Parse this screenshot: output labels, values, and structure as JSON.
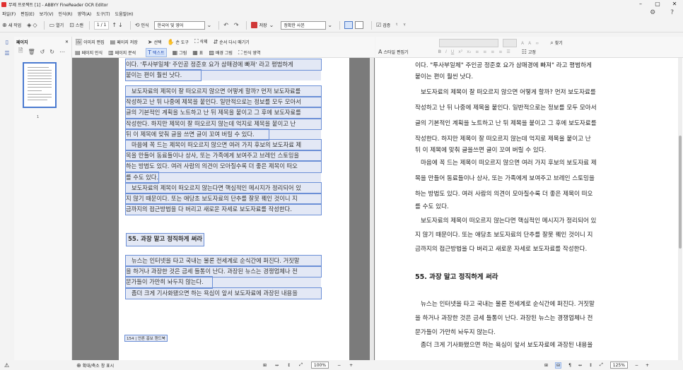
{
  "window": {
    "title": "무제 프로젝트 [1] - ABBYY FineReader OCR Editor",
    "minimize": "–",
    "maximize": "▢",
    "close": "✕"
  },
  "menu": [
    "파일(F)",
    "편집(E)",
    "보기(V)",
    "인식(R)",
    "영역(A)",
    "도구(T)",
    "도움말(H)"
  ],
  "toolbar": {
    "new_task": "새 작업",
    "open": "열기",
    "scan": "스캔",
    "page_counter": "1 / 1",
    "recognize": "인식",
    "language": "한국어 및 영어",
    "save": "저장",
    "save_format": "정확한 사본",
    "verify": "검증"
  },
  "pages_panel": {
    "title": "페이지",
    "page_number": "1"
  },
  "image_toolbar": {
    "row1": [
      "이미지 편집",
      "페이지 저장",
      "선택",
      "손 도구",
      "삭제",
      "순서 다시 매기기"
    ],
    "row2": [
      "페이지 인식",
      "페이지 분석",
      "텍스트",
      "그림",
      "표",
      "배경 그림",
      "인식 영역"
    ]
  },
  "image_page": {
    "lines_top": [
      "이다. '투사부일체' 주인공 정준호 요가 삼매경에 빠져' 라고 평범하게",
      "붙이는 편이 훨씬 낫다."
    ],
    "lines_para2": [
      "보도자료의 제목이 잘 떠오르지 않으면 어떻게 할까? 먼저 보도자료를",
      "작성하고 난 뒤 나중에 제목을 붙인다. 일반적으로는 정보를 모두 모아서",
      "글의 기본적인 계획을 노트하고 난 뒤 제목을 붙이고 그 후에 보도자료를",
      "작성한다. 하지만 제목이 잘 떠오르지 않는데 억지로 제목을 붙이고 난",
      "뒤 이 제목에 맞춰 글을 쓰면 글이 꼬여 버릴 수 있다.",
      "마음에 꼭 드는 제목이 떠오르지 않으면 여러 가지 후보의 보도자료 제",
      "목을 만들어 동료들이나 상사, 또는 가족에게 보여주고 브레인 스토밍을",
      "하는 방법도 있다. 여러 사람의 의견이 모아질수록 더 좋은 제목이 떠오",
      "를 수도 있다.",
      "보도자료의 제목이 떠오르지 않는다면 핵심적인 메시지가 정리되어 있",
      "지 않기 때문이다. 또는 애당초 보도자료의 단추를 잘못 꿰인 것이니 지",
      "금까지의 접근방법을 다 버리고 새로운 자세로 보도자료를 작성한다."
    ],
    "heading": "55. 과장 말고 정직하게 써라",
    "lines_para3": [
      "뉴스는 인터넷을 타고 국내는 물론 전세계로 순식간에 퍼진다. 거짓말",
      "을 하거나 과장한 것은 금세 들통이 난다. 과장된 뉴스는 경쟁업체나 전",
      "문가들이 가만히 놔두지 않는다.",
      "좀더 크게 기사화됐으면 하는 욕심이 앞서 보도자료에 과장된 내용을"
    ],
    "footer": "154 | 언론 홍보 핸드북"
  },
  "text_toolbar": {
    "style_editor": "스타일 편집기",
    "find": "찾기",
    "properties": "고정"
  },
  "text_view": {
    "paragraphs": [
      "이다. \"투사부일체\" 주인공 정준호 요가 삼매경에 빠져\" 라고 평범하게",
      "붙이는 편이 훨씬 낫다.",
      "보도자료의 제목이 잘 떠오르지 않으면 어떻게 할까? 먼저 보도자료를",
      "작성하고 난 뒤 나중에 제목을 붙인다. 일반적으로는 정보를 모두 모아서",
      "글의 기본적인 계획을 노트하고 난 뒤 제목을 붙이고 그 후에 보도자료를",
      "작성한다. 하지만 제목이 잘 떠오르지      않는데 억지로 제목을 붙이고 난",
      "뒤 이 제목에 맞춰 글을쓰면 글이 꼬여 버릴 수 있다.",
      "마음에 꼭 드는 제목이 떠오르지 않으면 여러 가지 후보의 보도자료 제",
      "목을 만들어 동료들이나 상사,      또는 가족에게 보여주고 브레인 스토밍을",
      "하는 방법도 있다. 여러 사람의 의견이 모아질수록 더          좋은 제목이 떠오",
      "를 수도 있다.",
      "보도자료의 제목이 떠오르지 않는다면 핵심적인 메시지가 정리되어 있",
      "지 않기 때문이다. 또는 애당초 보도자료의 단추를 잘못 꿰인 것이니 지",
      "금까지의 접근방법을 다 버리고 새로운 자세로 보도자료를 작성한다."
    ],
    "heading": "55. 과장 말고 정직하게 써라",
    "paragraphs2": [
      "뉴스는 인터넷을 타고 국내는 물론 전세계로 순식간에 퍼진다. 거짓말",
      "을 하거나 과장한 것은 금세 들통이 난다. 과장된 뉴스는 경쟁업체나 전",
      "문가들이 가만히 놔두지 않는다.",
      "좀더 크게 기사화됐으면 하는 욕심이 앞서 보도자료에 과장된 내용을"
    ]
  },
  "status": {
    "zoom_panel": "확대/축소 창 표시",
    "image_zoom": "100%",
    "text_zoom": "125%"
  }
}
